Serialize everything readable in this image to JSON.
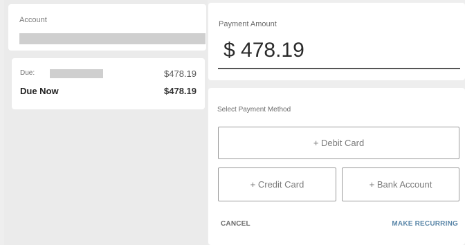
{
  "account": {
    "label": "Account"
  },
  "due": {
    "label": "Due:",
    "amount": "$478.19",
    "now_label": "Due Now",
    "now_amount": "$478.19"
  },
  "payment": {
    "amount_label": "Payment Amount",
    "amount_value": "$ 478.19",
    "method_label": "Select Payment Method",
    "methods": {
      "debit": "+ Debit Card",
      "credit": "+ Credit Card",
      "bank": "+ Bank Account"
    },
    "cancel_label": "CANCEL",
    "recurring_label": "MAKE RECURRING"
  },
  "colors": {
    "accent": "#5a86a8",
    "redacted": "#cfcfcf"
  }
}
